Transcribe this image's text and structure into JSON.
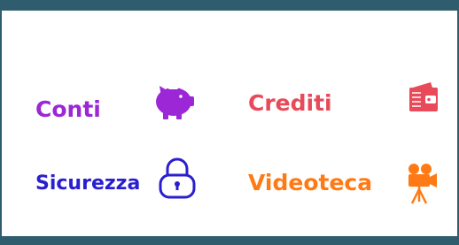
{
  "menu": {
    "items": [
      {
        "label": "Conti",
        "icon": "piggy-bank-icon",
        "color": "#9b27d6"
      },
      {
        "label": "Crediti",
        "icon": "wallet-icon",
        "color": "#e84a5a"
      },
      {
        "label": "Sicurezza",
        "icon": "padlock-icon",
        "color": "#2a1fd0"
      },
      {
        "label": "Videoteca",
        "icon": "movie-camera-icon",
        "color": "#ff7a14"
      }
    ]
  },
  "colors": {
    "frame": "#2f5d6e",
    "background": "#ffffff"
  }
}
